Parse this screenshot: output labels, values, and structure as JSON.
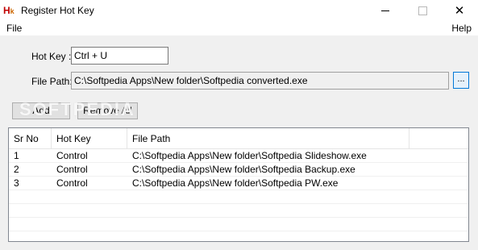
{
  "window": {
    "title": "Register Hot Key",
    "icon_text": "H",
    "icon_sub": "k",
    "minimize": "—",
    "maximize": "☐",
    "close": "✕"
  },
  "menu": {
    "file": "File",
    "help": "Help"
  },
  "form": {
    "hotkey_label": "Hot Key :",
    "hotkey_value": "Ctrl + U",
    "filepath_label": "File Path:",
    "filepath_value": "C:\\Softpedia Apps\\New folder\\Softpedia converted.exe",
    "browse_label": "...",
    "add_label": "Add",
    "remove_all_label": "Remove All"
  },
  "watermark": "SOFTPEDIA",
  "table": {
    "columns": [
      "Sr No",
      "Hot Key",
      "File Path"
    ],
    "rows": [
      [
        "1",
        "Control",
        "C:\\Softpedia Apps\\New folder\\Softpedia Slideshow.exe"
      ],
      [
        "2",
        "Control",
        "C:\\Softpedia Apps\\New folder\\Softpedia Backup.exe"
      ],
      [
        "3",
        "Control",
        "C:\\Softpedia Apps\\New folder\\Softpedia PW.exe"
      ]
    ]
  },
  "colors": {
    "icon_red": "#c00000",
    "browse_border": "#0078d7"
  }
}
